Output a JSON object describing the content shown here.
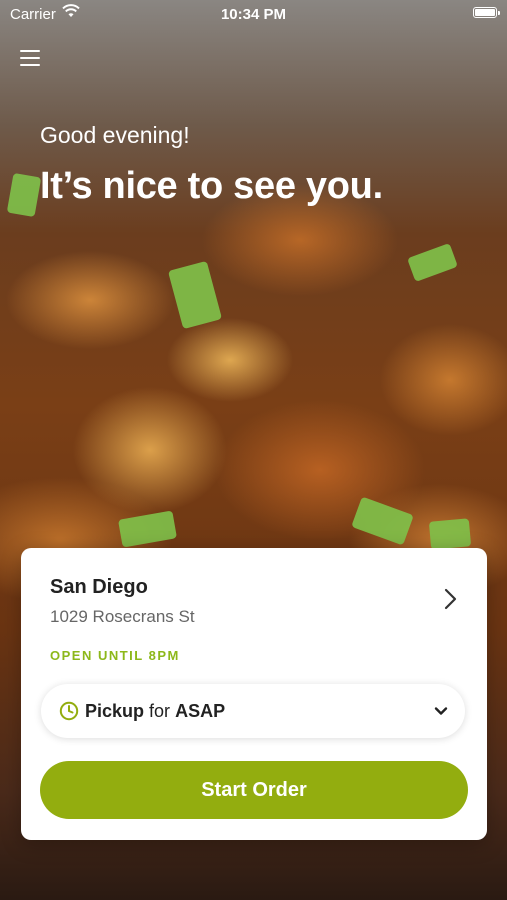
{
  "status_bar": {
    "carrier": "Carrier",
    "time": "10:34 PM",
    "icons": [
      "wifi-icon",
      "battery-icon"
    ]
  },
  "header": {
    "menu_icon": "hamburger-menu-icon",
    "greeting": "Good evening!",
    "headline": "It’s nice to see you."
  },
  "location_card": {
    "name": "San Diego",
    "address": "1029 Rosecrans St",
    "open_status": "OPEN UNTIL 8PM",
    "chevron_icon": "chevron-right-icon"
  },
  "order_options": {
    "mode": "Pickup",
    "connector": "for",
    "time": "ASAP",
    "icons": [
      "clock-icon",
      "chevron-down-icon"
    ]
  },
  "actions": {
    "start_order_label": "Start Order"
  },
  "colors": {
    "accent_green": "#93ad0f",
    "open_status_green": "#8db81a",
    "card_background": "#ffffff"
  }
}
